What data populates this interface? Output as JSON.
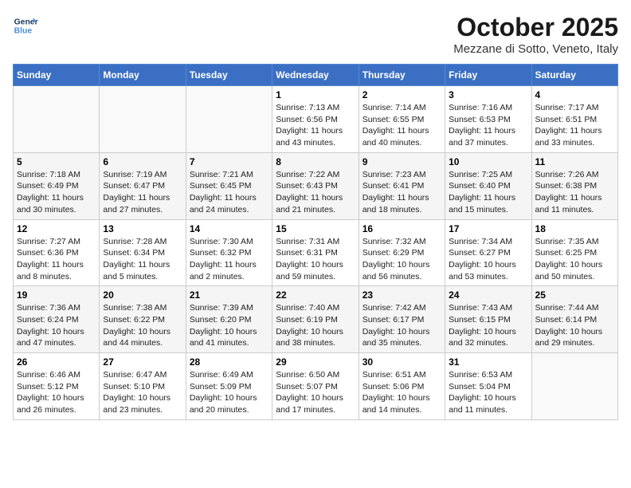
{
  "logo": {
    "line1": "General",
    "line2": "Blue"
  },
  "title": "October 2025",
  "subtitle": "Mezzane di Sotto, Veneto, Italy",
  "headers": [
    "Sunday",
    "Monday",
    "Tuesday",
    "Wednesday",
    "Thursday",
    "Friday",
    "Saturday"
  ],
  "weeks": [
    [
      {
        "day": "",
        "info": ""
      },
      {
        "day": "",
        "info": ""
      },
      {
        "day": "",
        "info": ""
      },
      {
        "day": "1",
        "info": "Sunrise: 7:13 AM\nSunset: 6:56 PM\nDaylight: 11 hours and 43 minutes."
      },
      {
        "day": "2",
        "info": "Sunrise: 7:14 AM\nSunset: 6:55 PM\nDaylight: 11 hours and 40 minutes."
      },
      {
        "day": "3",
        "info": "Sunrise: 7:16 AM\nSunset: 6:53 PM\nDaylight: 11 hours and 37 minutes."
      },
      {
        "day": "4",
        "info": "Sunrise: 7:17 AM\nSunset: 6:51 PM\nDaylight: 11 hours and 33 minutes."
      }
    ],
    [
      {
        "day": "5",
        "info": "Sunrise: 7:18 AM\nSunset: 6:49 PM\nDaylight: 11 hours and 30 minutes."
      },
      {
        "day": "6",
        "info": "Sunrise: 7:19 AM\nSunset: 6:47 PM\nDaylight: 11 hours and 27 minutes."
      },
      {
        "day": "7",
        "info": "Sunrise: 7:21 AM\nSunset: 6:45 PM\nDaylight: 11 hours and 24 minutes."
      },
      {
        "day": "8",
        "info": "Sunrise: 7:22 AM\nSunset: 6:43 PM\nDaylight: 11 hours and 21 minutes."
      },
      {
        "day": "9",
        "info": "Sunrise: 7:23 AM\nSunset: 6:41 PM\nDaylight: 11 hours and 18 minutes."
      },
      {
        "day": "10",
        "info": "Sunrise: 7:25 AM\nSunset: 6:40 PM\nDaylight: 11 hours and 15 minutes."
      },
      {
        "day": "11",
        "info": "Sunrise: 7:26 AM\nSunset: 6:38 PM\nDaylight: 11 hours and 11 minutes."
      }
    ],
    [
      {
        "day": "12",
        "info": "Sunrise: 7:27 AM\nSunset: 6:36 PM\nDaylight: 11 hours and 8 minutes."
      },
      {
        "day": "13",
        "info": "Sunrise: 7:28 AM\nSunset: 6:34 PM\nDaylight: 11 hours and 5 minutes."
      },
      {
        "day": "14",
        "info": "Sunrise: 7:30 AM\nSunset: 6:32 PM\nDaylight: 11 hours and 2 minutes."
      },
      {
        "day": "15",
        "info": "Sunrise: 7:31 AM\nSunset: 6:31 PM\nDaylight: 10 hours and 59 minutes."
      },
      {
        "day": "16",
        "info": "Sunrise: 7:32 AM\nSunset: 6:29 PM\nDaylight: 10 hours and 56 minutes."
      },
      {
        "day": "17",
        "info": "Sunrise: 7:34 AM\nSunset: 6:27 PM\nDaylight: 10 hours and 53 minutes."
      },
      {
        "day": "18",
        "info": "Sunrise: 7:35 AM\nSunset: 6:25 PM\nDaylight: 10 hours and 50 minutes."
      }
    ],
    [
      {
        "day": "19",
        "info": "Sunrise: 7:36 AM\nSunset: 6:24 PM\nDaylight: 10 hours and 47 minutes."
      },
      {
        "day": "20",
        "info": "Sunrise: 7:38 AM\nSunset: 6:22 PM\nDaylight: 10 hours and 44 minutes."
      },
      {
        "day": "21",
        "info": "Sunrise: 7:39 AM\nSunset: 6:20 PM\nDaylight: 10 hours and 41 minutes."
      },
      {
        "day": "22",
        "info": "Sunrise: 7:40 AM\nSunset: 6:19 PM\nDaylight: 10 hours and 38 minutes."
      },
      {
        "day": "23",
        "info": "Sunrise: 7:42 AM\nSunset: 6:17 PM\nDaylight: 10 hours and 35 minutes."
      },
      {
        "day": "24",
        "info": "Sunrise: 7:43 AM\nSunset: 6:15 PM\nDaylight: 10 hours and 32 minutes."
      },
      {
        "day": "25",
        "info": "Sunrise: 7:44 AM\nSunset: 6:14 PM\nDaylight: 10 hours and 29 minutes."
      }
    ],
    [
      {
        "day": "26",
        "info": "Sunrise: 6:46 AM\nSunset: 5:12 PM\nDaylight: 10 hours and 26 minutes."
      },
      {
        "day": "27",
        "info": "Sunrise: 6:47 AM\nSunset: 5:10 PM\nDaylight: 10 hours and 23 minutes."
      },
      {
        "day": "28",
        "info": "Sunrise: 6:49 AM\nSunset: 5:09 PM\nDaylight: 10 hours and 20 minutes."
      },
      {
        "day": "29",
        "info": "Sunrise: 6:50 AM\nSunset: 5:07 PM\nDaylight: 10 hours and 17 minutes."
      },
      {
        "day": "30",
        "info": "Sunrise: 6:51 AM\nSunset: 5:06 PM\nDaylight: 10 hours and 14 minutes."
      },
      {
        "day": "31",
        "info": "Sunrise: 6:53 AM\nSunset: 5:04 PM\nDaylight: 10 hours and 11 minutes."
      },
      {
        "day": "",
        "info": ""
      }
    ]
  ]
}
